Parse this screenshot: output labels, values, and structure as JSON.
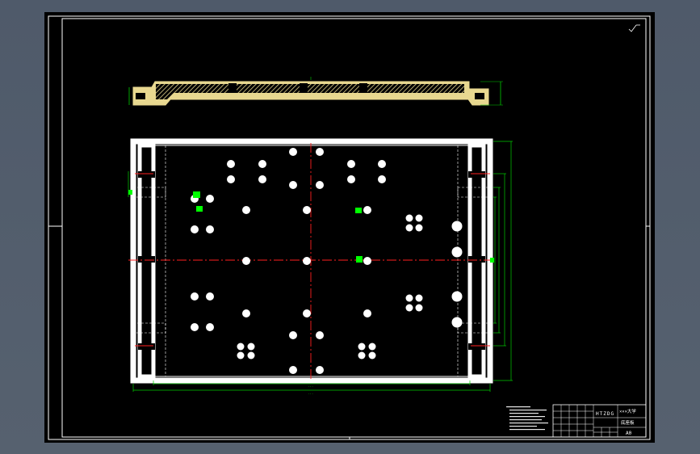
{
  "title_block": {
    "drawing_code": "HTZDG",
    "school": "×××大学",
    "part_name": "底座板",
    "sheet_size": "A0"
  },
  "colors": {
    "background": "#000000",
    "outline": "#ffffff",
    "hatch": "#e8d890",
    "center_line": "#ff2020",
    "dimension": "#00cc00",
    "highlight": "#00ff00",
    "desktop": "#55606e"
  },
  "icons": {
    "hole": "white-circle",
    "datum": "green-square"
  }
}
